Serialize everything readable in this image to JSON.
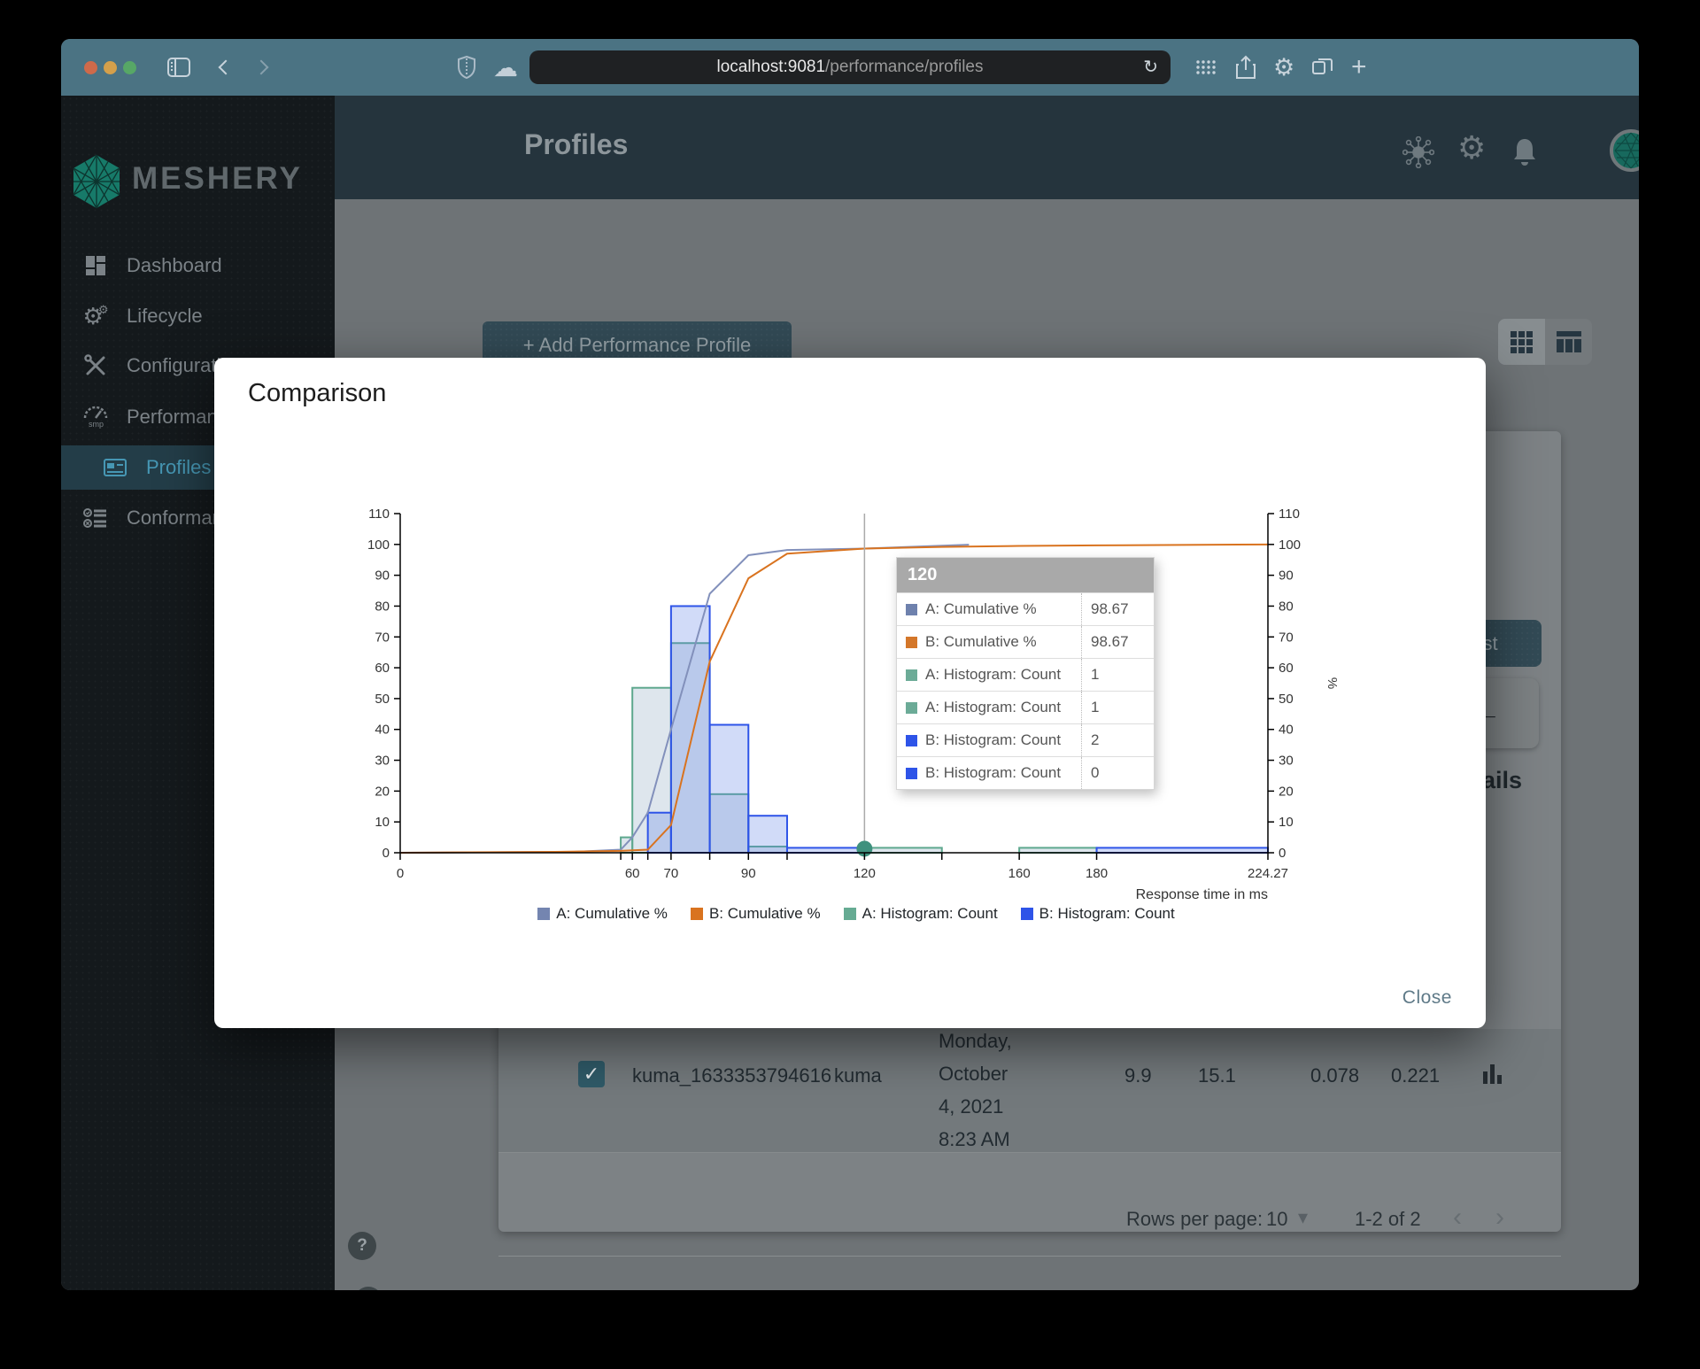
{
  "browser": {
    "url_host": "localhost:9081",
    "url_path": "/performance/profiles",
    "refresh_glyph": "↻",
    "plus_glyph": "+"
  },
  "sidebar": {
    "brand": "MESHERY",
    "items": [
      {
        "label": "Dashboard"
      },
      {
        "label": "Lifecycle"
      },
      {
        "label": "Configuration"
      },
      {
        "label": "Performance"
      },
      {
        "label": "Profiles"
      },
      {
        "label": "Conformance"
      }
    ],
    "help_glyph": "?",
    "collapse_glyph": "‹"
  },
  "header": {
    "title": "Profiles"
  },
  "content": {
    "add_button_label": "+ Add Performance Profile",
    "test_button_label": "Test",
    "back_arrow_glyph": "←",
    "details_partial_text": "ails",
    "table_row": {
      "name": "kuma_1633353794616",
      "mesh": "kuma",
      "date_lines": [
        "Monday,",
        "October",
        "4, 2021",
        "8:23 AM"
      ],
      "qps": "9.9",
      "duration": "15.1",
      "p50": "0.078",
      "p99": "0.221",
      "checkbox_checked": "✓"
    },
    "pagination": {
      "rows_per_page_label": "Rows per page:",
      "rows_per_page_value": "10",
      "caret_glyph": "▾",
      "range_text": "1-2 of 2",
      "prev_glyph": "‹",
      "next_glyph": "›"
    }
  },
  "modal": {
    "title": "Comparison",
    "close_label": "Close",
    "tooltip": {
      "header": "120",
      "rows": [
        {
          "swatch": "#6e81ad",
          "label": "A: Cumulative %",
          "value": "98.67"
        },
        {
          "swatch": "#d4772a",
          "label": "B: Cumulative %",
          "value": "98.67"
        },
        {
          "swatch": "#6cab97",
          "label": "A: Histogram: Count",
          "value": "1"
        },
        {
          "swatch": "#6cab97",
          "label": "A: Histogram: Count",
          "value": "1"
        },
        {
          "swatch": "#2e54e8",
          "label": "B: Histogram: Count",
          "value": "2"
        },
        {
          "swatch": "#2e54e8",
          "label": "B: Histogram: Count",
          "value": "0"
        }
      ]
    }
  },
  "chart_data": {
    "type": "line",
    "subtype": "cumulative-percent-lines-with-histogram-bars",
    "xlabel": "Response time in ms",
    "ylabel_right": "%",
    "xlim": [
      0,
      224.27
    ],
    "ylim": [
      0,
      110
    ],
    "y_tick_step": 10,
    "x_labeled_ticks": [
      0,
      60,
      70,
      90,
      120,
      160,
      180,
      224.27
    ],
    "x_minor_ticks": [
      57,
      64,
      80,
      100,
      140
    ],
    "grid": "off",
    "legend_position": "bottom",
    "legend": [
      {
        "label": "A: Cumulative %",
        "color": "#7485b0"
      },
      {
        "label": "B: Cumulative %",
        "color": "#d9731f"
      },
      {
        "label": "A: Histogram: Count",
        "color": "#66ab93"
      },
      {
        "label": "B: Histogram: Count",
        "color": "#2e54e8"
      }
    ],
    "series": [
      {
        "name": "A: Cumulative %",
        "type": "line",
        "color": "#8290bb",
        "points": [
          [
            0,
            0
          ],
          [
            45,
            0.3
          ],
          [
            57,
            1
          ],
          [
            60,
            5
          ],
          [
            64,
            13
          ],
          [
            70,
            40
          ],
          [
            80,
            84
          ],
          [
            90,
            96.5
          ],
          [
            100,
            98.2
          ],
          [
            120,
            98.67
          ],
          [
            140,
            99.6
          ],
          [
            147,
            99.9
          ]
        ]
      },
      {
        "name": "B: Cumulative %",
        "type": "line",
        "color": "#d9731f",
        "points": [
          [
            0,
            0
          ],
          [
            40,
            0.3
          ],
          [
            57,
            0.6
          ],
          [
            64,
            1
          ],
          [
            70,
            9
          ],
          [
            80,
            62
          ],
          [
            90,
            89
          ],
          [
            100,
            97
          ],
          [
            120,
            98.67
          ],
          [
            140,
            99.2
          ],
          [
            160,
            99.5
          ],
          [
            180,
            99.7
          ],
          [
            224.27,
            100
          ]
        ]
      },
      {
        "name": "A: Histogram: Count",
        "type": "bars",
        "stroke": "#5ea88e",
        "fill": "rgba(125,155,185,0.25)",
        "bars": [
          [
            57,
            60,
            5
          ],
          [
            60,
            70,
            53.5
          ],
          [
            70,
            80,
            68
          ],
          [
            80,
            90,
            19
          ],
          [
            90,
            100,
            2
          ],
          [
            120,
            140,
            1.6
          ],
          [
            160,
            180,
            1.6
          ]
        ]
      },
      {
        "name": "B: Histogram: Count",
        "type": "bars",
        "stroke": "#2e54e8",
        "fill": "rgba(90,125,230,0.28)",
        "bars": [
          [
            64,
            70,
            13
          ],
          [
            70,
            80,
            80
          ],
          [
            80,
            90,
            41.5
          ],
          [
            90,
            100,
            12
          ],
          [
            100,
            120,
            1.6
          ],
          [
            180,
            224.27,
            1.6
          ]
        ]
      }
    ],
    "crosshair_x": 120,
    "marker": {
      "x": 120,
      "y": 1.3,
      "color": "#3f917e"
    }
  }
}
